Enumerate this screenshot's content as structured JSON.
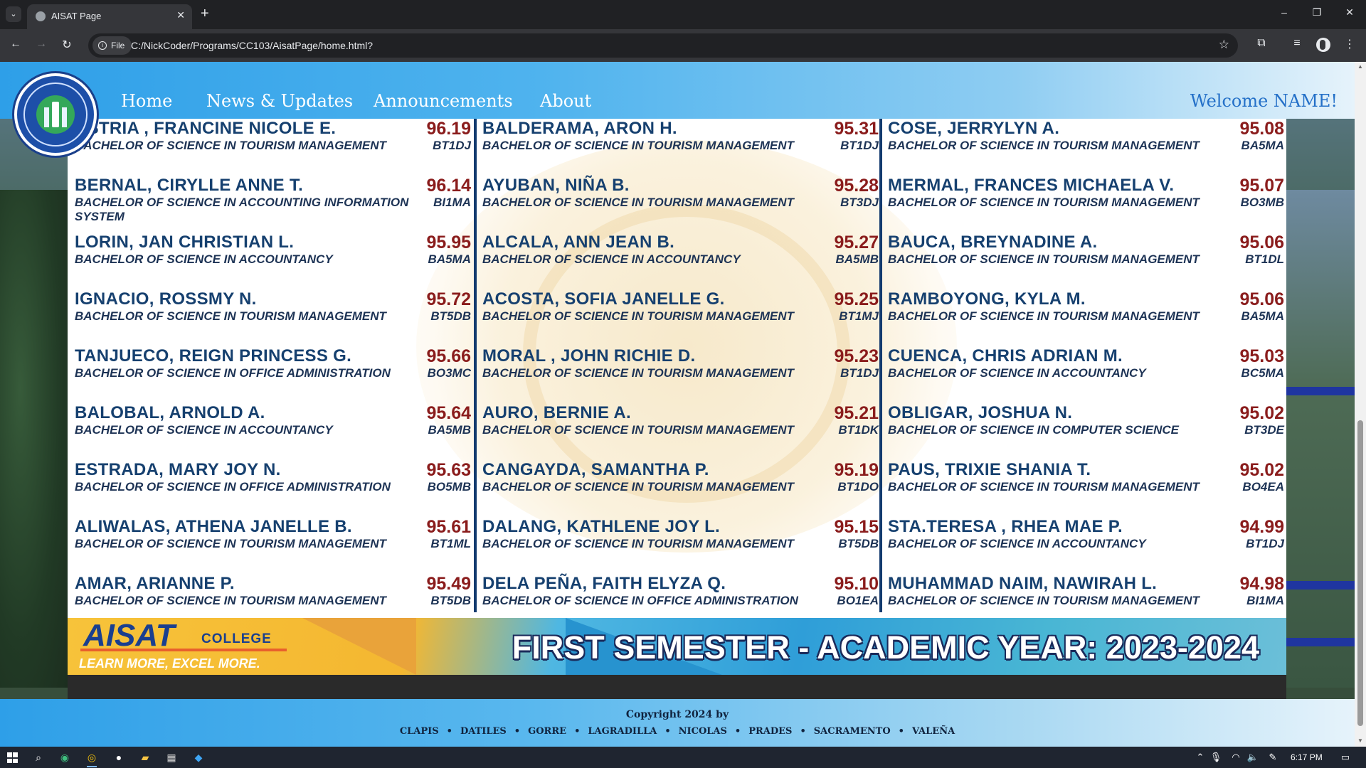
{
  "browser": {
    "tab_title": "AISAT Page",
    "tab_close": "✕",
    "new_tab": "+",
    "url": "C:/NickCoder/Programs/CC103/AisatPage/home.html?",
    "site_info": "File",
    "window_controls": [
      "–",
      "❐",
      "✕"
    ]
  },
  "nav": {
    "links": [
      "Home",
      "News & Updates",
      "Announcements",
      "About"
    ],
    "welcome": "Welcome NAME!"
  },
  "poster": {
    "columns": [
      [
        {
          "name": "USTRIA , FRANCINE NICOLE E.",
          "score": "96.19",
          "program": "BACHELOR OF SCIENCE IN TOURISM MANAGEMENT",
          "section": "BT1DJ"
        },
        {
          "name": "BERNAL, CIRYLLE ANNE T.",
          "score": "96.14",
          "program": "BACHELOR OF SCIENCE IN ACCOUNTING INFORMATION SYSTEM",
          "section": "BI1MA"
        },
        {
          "name": "LORIN, JAN CHRISTIAN L.",
          "score": "95.95",
          "program": "BACHELOR OF SCIENCE IN ACCOUNTANCY",
          "section": "BA5MA"
        },
        {
          "name": "IGNACIO, ROSSMY N.",
          "score": "95.72",
          "program": "BACHELOR OF SCIENCE IN TOURISM MANAGEMENT",
          "section": "BT5DB"
        },
        {
          "name": "TANJUECO, REIGN PRINCESS G.",
          "score": "95.66",
          "program": "BACHELOR OF SCIENCE IN OFFICE ADMINISTRATION",
          "section": "BO3MC"
        },
        {
          "name": "BALOBAL, ARNOLD A.",
          "score": "95.64",
          "program": "BACHELOR OF SCIENCE IN ACCOUNTANCY",
          "section": "BA5MB"
        },
        {
          "name": "ESTRADA, MARY JOY N.",
          "score": "95.63",
          "program": "BACHELOR OF SCIENCE IN OFFICE ADMINISTRATION",
          "section": "BO5MB"
        },
        {
          "name": "ALIWALAS, ATHENA JANELLE B.",
          "score": "95.61",
          "program": "BACHELOR OF SCIENCE IN TOURISM MANAGEMENT",
          "section": "BT1ML"
        },
        {
          "name": "AMAR, ARIANNE P.",
          "score": "95.49",
          "program": "BACHELOR OF SCIENCE IN TOURISM MANAGEMENT",
          "section": "BT5DB"
        }
      ],
      [
        {
          "name": "BALDERAMA, ARON H.",
          "score": "95.31",
          "program": "BACHELOR OF SCIENCE IN TOURISM MANAGEMENT",
          "section": "BT1DJ"
        },
        {
          "name": "AYUBAN, NIÑA B.",
          "score": "95.28",
          "program": "BACHELOR OF SCIENCE IN TOURISM MANAGEMENT",
          "section": "BT3DJ"
        },
        {
          "name": "ALCALA, ANN JEAN B.",
          "score": "95.27",
          "program": "BACHELOR OF SCIENCE IN ACCOUNTANCY",
          "section": "BA5MB"
        },
        {
          "name": "ACOSTA, SOFIA JANELLE G.",
          "score": "95.25",
          "program": "BACHELOR OF SCIENCE IN TOURISM MANAGEMENT",
          "section": "BT1MJ"
        },
        {
          "name": "MORAL , JOHN RICHIE D.",
          "score": "95.23",
          "program": "BACHELOR OF SCIENCE IN TOURISM MANAGEMENT",
          "section": "BT1DJ"
        },
        {
          "name": "AURO, BERNIE A.",
          "score": "95.21",
          "program": "BACHELOR OF SCIENCE IN TOURISM MANAGEMENT",
          "section": "BT1DK"
        },
        {
          "name": "CANGAYDA, SAMANTHA P.",
          "score": "95.19",
          "program": "BACHELOR OF SCIENCE IN TOURISM MANAGEMENT",
          "section": "BT1DO"
        },
        {
          "name": "DALANG, KATHLENE JOY L.",
          "score": "95.15",
          "program": "BACHELOR OF SCIENCE IN TOURISM MANAGEMENT",
          "section": "BT5DB"
        },
        {
          "name": "DELA PEÑA, FAITH ELYZA Q.",
          "score": "95.10",
          "program": "BACHELOR OF SCIENCE IN OFFICE ADMINISTRATION",
          "section": "BO1EA"
        }
      ],
      [
        {
          "name": "COSE, JERRYLYN A.",
          "score": "95.08",
          "program": "BACHELOR OF SCIENCE IN TOURISM MANAGEMENT",
          "section": "BA5MA"
        },
        {
          "name": "MERMAL, FRANCES MICHAELA V.",
          "score": "95.07",
          "program": "BACHELOR OF SCIENCE IN TOURISM MANAGEMENT",
          "section": "BO3MB"
        },
        {
          "name": "BAUCA, BREYNADINE A.",
          "score": "95.06",
          "program": "BACHELOR OF SCIENCE IN TOURISM MANAGEMENT",
          "section": "BT1DL"
        },
        {
          "name": "RAMBOYONG, KYLA M.",
          "score": "95.06",
          "program": "BACHELOR OF SCIENCE IN TOURISM MANAGEMENT",
          "section": "BA5MA"
        },
        {
          "name": "CUENCA, CHRIS ADRIAN M.",
          "score": "95.03",
          "program": "BACHELOR OF SCIENCE IN ACCOUNTANCY",
          "section": "BC5MA"
        },
        {
          "name": "OBLIGAR, JOSHUA N.",
          "score": "95.02",
          "program": "BACHELOR OF SCIENCE IN COMPUTER SCIENCE",
          "section": "BT3DE"
        },
        {
          "name": "PAUS, TRIXIE SHANIA T.",
          "score": "95.02",
          "program": "BACHELOR OF SCIENCE IN TOURISM MANAGEMENT",
          "section": "BO4EA"
        },
        {
          "name": "STA.TERESA , RHEA MAE P.",
          "score": "94.99",
          "program": "BACHELOR OF SCIENCE IN ACCOUNTANCY",
          "section": "BT1DJ"
        },
        {
          "name": "MUHAMMAD NAIM, NAWIRAH L.",
          "score": "94.98",
          "program": "BACHELOR OF SCIENCE IN TOURISM MANAGEMENT",
          "section": "BI1MA"
        }
      ]
    ],
    "banner": {
      "brand": "AISAT",
      "college": "COLLEGE",
      "tagline": "LEARN MORE, EXCEL MORE.",
      "semester": "FIRST SEMESTER - ACADEMIC YEAR: 2023-2024"
    }
  },
  "footer": {
    "copyright": "Copyright 2024 by",
    "credits": [
      "CLAPIS",
      "DATILES",
      "GORRE",
      "LAGRADILLA",
      "NICOLAS",
      "PRADES",
      "SACRAMENTO",
      "VALEÑA"
    ],
    "separator": "•"
  },
  "taskbar": {
    "time": "6:17 PM"
  },
  "colors": {
    "nav_gradient_start": "#2e9fe8",
    "name_blue": "#16406f",
    "score_red": "#8a1c1c",
    "welcome_blue": "#2470c8"
  }
}
